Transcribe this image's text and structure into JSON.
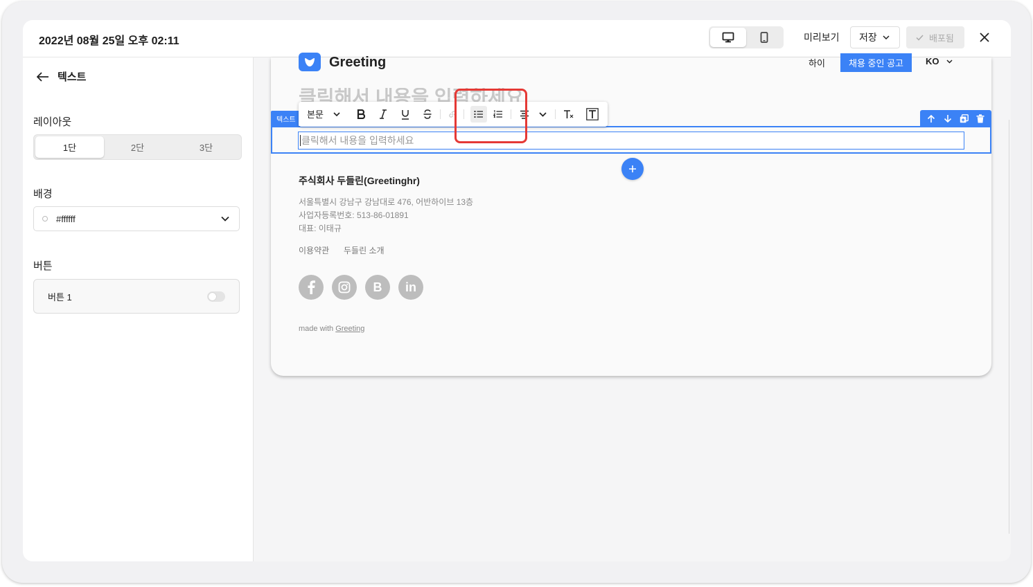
{
  "header": {
    "title": "2022년 08월 25일 오후 02:11",
    "preview_label": "미리보기",
    "save_label": "저장",
    "deploy_label": "배포됨"
  },
  "sidebar": {
    "back_label": "텍스트",
    "layout_label": "레이아웃",
    "layout_options": [
      "1단",
      "2단",
      "3단"
    ],
    "layout_selected": "1단",
    "background_label": "배경",
    "background_value": "#ffffff",
    "button_section_label": "버튼",
    "button_item_label": "버튼 1",
    "button_item_enabled": false
  },
  "site": {
    "logo_text": "Greeting",
    "nav_link": "하이",
    "nav_jobs": "채용 중인 공고",
    "nav_lang": "KO",
    "heading_placeholder": "클릭해서 내용을 입력하세요"
  },
  "editor": {
    "block_tag": "텍스트",
    "text_style": "본문",
    "placeholder": "클릭해서 내용을 입력하세요",
    "active_tool": "bullet-list"
  },
  "footer": {
    "company": "주식회사 두들린(Greetinghr)",
    "address": "서울특별시 강남구 강남대로 476, 어반하이브 13층",
    "biz_number": "사업자등록번호: 513-86-01891",
    "ceo": "대표: 이태규",
    "links": [
      "이용약관",
      "두들린 소개"
    ],
    "social": [
      "facebook",
      "instagram",
      "blog",
      "linkedin"
    ],
    "made_with_prefix": "made with",
    "made_with_link": "Greeting"
  },
  "colors": {
    "accent": "#3b82f6",
    "highlight": "#e53935",
    "social_bg": "#bdbdbd"
  }
}
